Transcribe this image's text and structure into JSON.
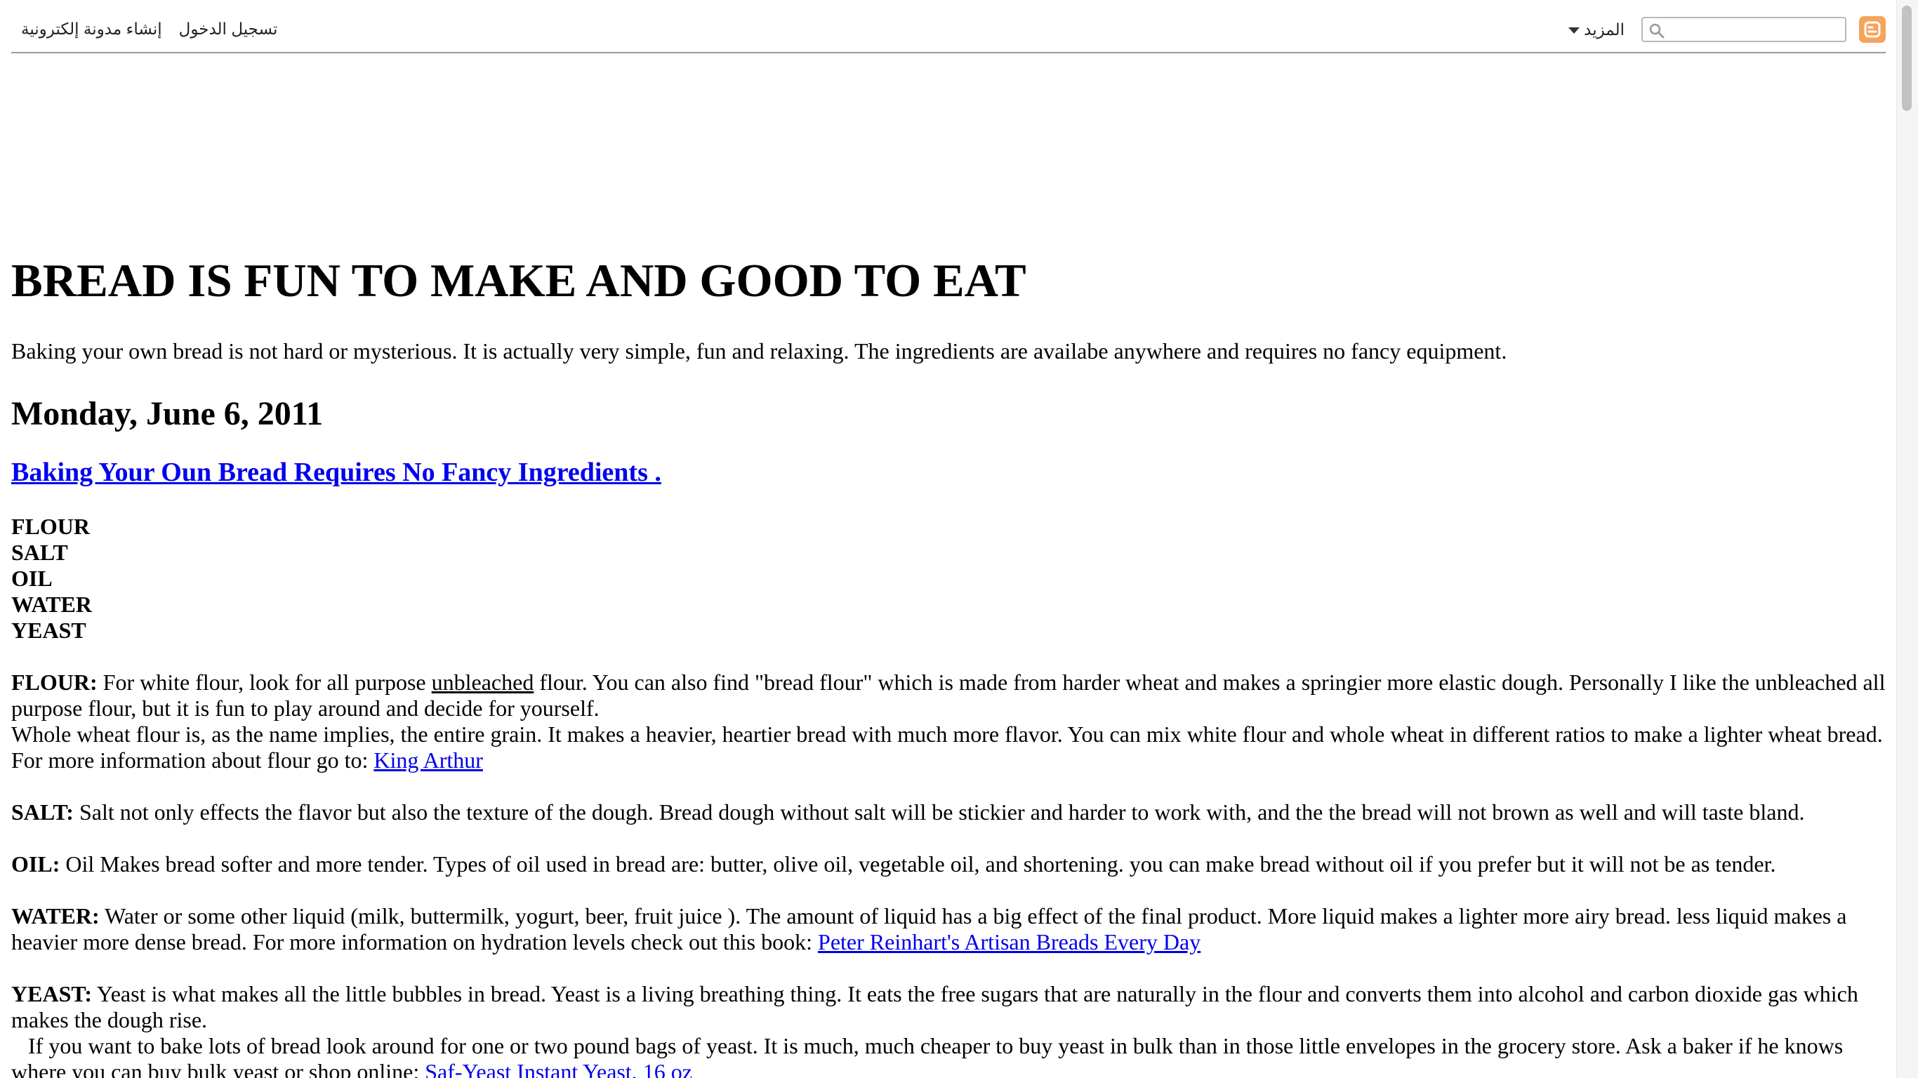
{
  "navbar": {
    "logo_icon": "blogger-logo-icon",
    "search_placeholder": "",
    "more_label": "المزيد",
    "create_blog_label": "إنشاء مدونة إلكترونية",
    "sign_in_label": "تسجيل الدخول"
  },
  "blog": {
    "title": "BREAD IS FUN TO MAKE AND GOOD TO EAT",
    "description": "Baking your own bread is not hard or mysterious. It is actually very simple, fun and relaxing. The ingredients are availabe anywhere and requires no fancy equipment."
  },
  "post": {
    "date": "Monday, June 6, 2011",
    "title": "Baking Your Oun Bread Requires No Fancy Ingredients .",
    "ingredients": [
      "FLOUR",
      "SALT",
      "OIL",
      "WATER",
      "YEAST"
    ],
    "flour": {
      "label": "FLOUR:",
      "text_a": " For white flour, look for all purpose ",
      "underlined": "unbleached",
      "text_b": " flour. You can also find \"bread flour\" which is made from harder wheat and makes a springier more elastic dough. Personally I like the unbleached all purpose flour, but it is fun to play around and decide for yourself.",
      "text_c": "Whole wheat flour is, as the name implies, the entire grain. It makes a heavier, heartier bread with much more flavor. You can mix white flour and whole wheat in different ratios to make a lighter wheat bread.",
      "text_d": "For more information about flour go to: ",
      "link": "King Arthur"
    },
    "salt": {
      "label": "SALT:",
      "text": " Salt not only effects the flavor but also the texture of the dough. Bread dough without salt will be stickier and harder to work with, and the the bread will not brown as well and will taste bland."
    },
    "oil": {
      "label": "OIL:",
      "text": " Oil Makes bread softer and more tender. Types of oil used in bread are: butter, olive oil, vegetable oil, and shortening. you can make bread without oil if you prefer but it will not be as tender."
    },
    "water": {
      "label": "WATER:",
      "text": " Water or some other liquid (milk, buttermilk, yogurt, beer, fruit juice ). The amount of liquid has a big effect of the final product. More liquid makes a lighter more airy bread. less liquid makes a heavier more dense bread. For more information on hydration levels check out this book: ",
      "link": "Peter Reinhart's Artisan Breads Every Day"
    },
    "yeast": {
      "label": "YEAST:",
      "text_a": " Yeast is what makes all the little bubbles in bread. Yeast is a living breathing thing. It eats the free sugars that are naturally in the flour and converts them into alcohol and carbon dioxide gas which makes the dough rise.",
      "text_b": "   If you want to bake lots of bread look around for one or two pound bags of yeast. It is much, much cheaper to buy yeast in bulk than in those little envelopes in the grocery store. Ask a baker if he knows where you can buy bulk yeast or shop online: ",
      "link": "Saf-Yeast Instant Yeast, 16 oz"
    }
  }
}
